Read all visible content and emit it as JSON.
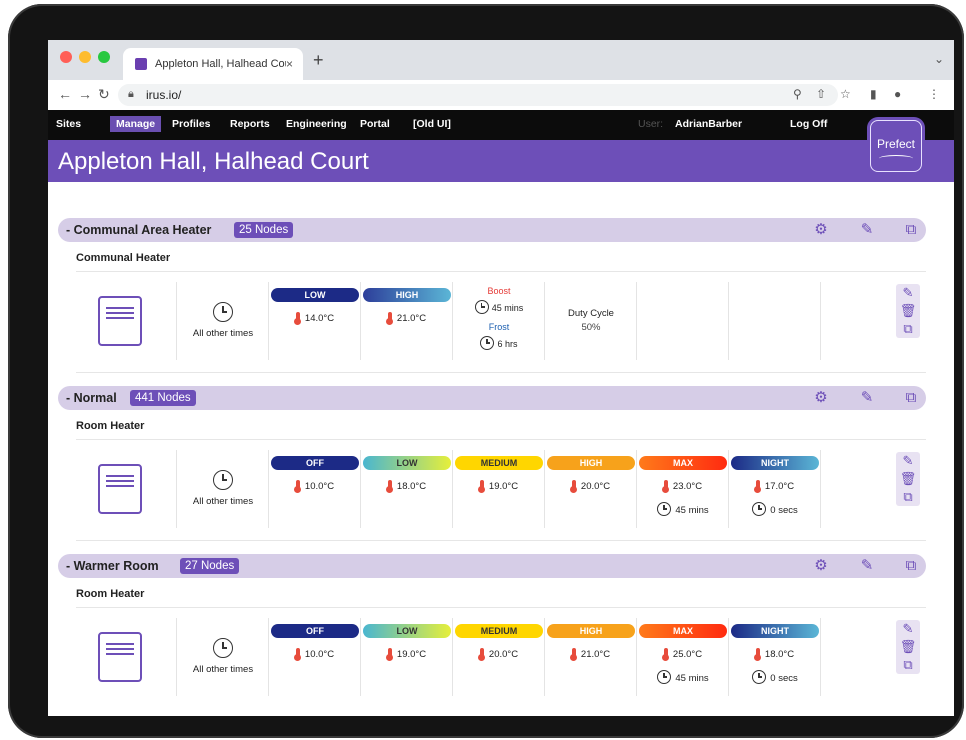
{
  "browser": {
    "tab_title": "Appleton Hall, Halhead Court",
    "tab_close": "×",
    "new_tab": "+",
    "url": "irus.io/"
  },
  "app": {
    "menu": [
      "Sites",
      "Manage",
      "Profiles",
      "Reports",
      "Engineering",
      "Portal",
      "[Old UI]"
    ],
    "active_menu": "Manage",
    "user_label": "User:",
    "user_name": "AdrianBarber",
    "logoff": "Log Off",
    "logo_text": "Prefect",
    "page_title": "Appleton Hall, Halhead Court"
  },
  "colors": {
    "brand_purple": "#6d4fb8",
    "off": "#1c2a86",
    "low": "#63c1c9",
    "medium": "#ffd600",
    "high": "#f7a21b",
    "max": "#ff4c14",
    "night": "#3b6fc4"
  },
  "sections": [
    {
      "name": "- Communal Area Heater",
      "nodes": "25 Nodes",
      "subtitle": "Communal Heater",
      "all_other_times": "All other times",
      "modes": [
        {
          "label": "LOW",
          "temp": "14.0°C",
          "style": "low"
        },
        {
          "label": "HIGH",
          "temp": "21.0°C",
          "style": "high"
        }
      ],
      "boost_label": "Boost",
      "boost_time": "45 mins",
      "frost_label": "Frost",
      "frost_time": "6 hrs",
      "duty_label": "Duty Cycle",
      "duty_value": "50%"
    },
    {
      "name": "- Normal",
      "nodes": "441 Nodes",
      "subtitle": "Room Heater",
      "all_other_times": "All other times",
      "modes": [
        {
          "label": "OFF",
          "temp": "10.0°C",
          "style": "off",
          "timer": ""
        },
        {
          "label": "LOW",
          "temp": "18.0°C",
          "style": "low",
          "timer": ""
        },
        {
          "label": "MEDIUM",
          "temp": "19.0°C",
          "style": "medium",
          "timer": ""
        },
        {
          "label": "HIGH",
          "temp": "20.0°C",
          "style": "high",
          "timer": ""
        },
        {
          "label": "MAX",
          "temp": "23.0°C",
          "style": "max",
          "timer": "45 mins"
        },
        {
          "label": "NIGHT",
          "temp": "17.0°C",
          "style": "night",
          "timer": "0 secs"
        }
      ]
    },
    {
      "name": "- Warmer Room",
      "nodes": "27 Nodes",
      "subtitle": "Room Heater",
      "all_other_times": "All other times",
      "modes": [
        {
          "label": "OFF",
          "temp": "10.0°C",
          "style": "off",
          "timer": ""
        },
        {
          "label": "LOW",
          "temp": "19.0°C",
          "style": "low",
          "timer": ""
        },
        {
          "label": "MEDIUM",
          "temp": "20.0°C",
          "style": "medium",
          "timer": ""
        },
        {
          "label": "HIGH",
          "temp": "21.0°C",
          "style": "high",
          "timer": ""
        },
        {
          "label": "MAX",
          "temp": "25.0°C",
          "style": "max",
          "timer": "45 mins"
        },
        {
          "label": "NIGHT",
          "temp": "18.0°C",
          "style": "night",
          "timer": "0 secs"
        }
      ]
    }
  ]
}
